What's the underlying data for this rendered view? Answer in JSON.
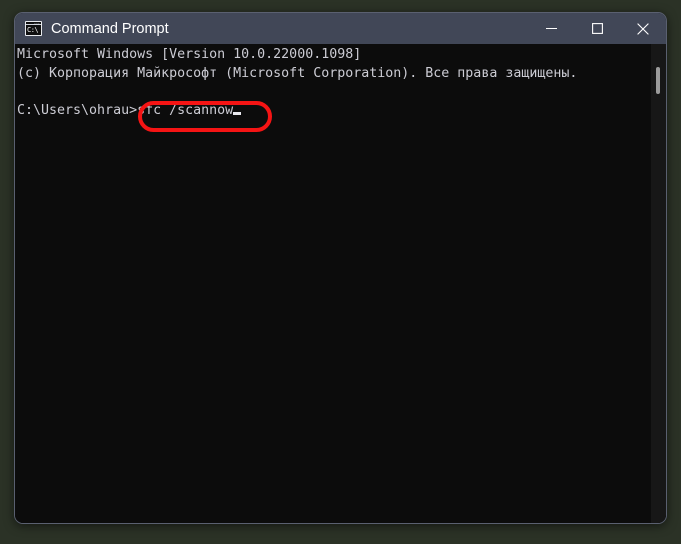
{
  "window": {
    "title": "Command Prompt",
    "icon": "cmd-console-icon",
    "icon_text": "C:\\",
    "controls": [
      {
        "name": "minimize",
        "glyph": "minimize-icon"
      },
      {
        "name": "maximize",
        "glyph": "maximize-icon"
      },
      {
        "name": "close",
        "glyph": "close-icon"
      }
    ]
  },
  "terminal": {
    "lines": [
      "Microsoft Windows [Version 10.0.22000.1098]",
      "(c) Корпорация Майкрософт (Microsoft Corporation). Все права защищены.",
      "",
      "C:\\Users\\ohrau>sfc /scannow"
    ],
    "version_line": "Microsoft Windows [Version 10.0.22000.1098]",
    "copyright_line": "(c) Корпорация Майкрософт (Microsoft Corporation). Все права защищены.",
    "prompt_path": "C:\\Users\\ohrau>",
    "command": "sfc /scannow",
    "cursor": "underscore-block"
  },
  "annotation": {
    "type": "rounded-rectangle-highlight",
    "color": "#f51414",
    "targets": ">sfc /scannow"
  },
  "colors": {
    "page_background": "#2b3226",
    "titlebar": "#414757",
    "terminal_background": "#0c0c0c",
    "terminal_text": "#ccccd4",
    "window_border": "#5a6070",
    "scrollbar_thumb": "#9b9b9b",
    "annotation": "#f51414"
  }
}
